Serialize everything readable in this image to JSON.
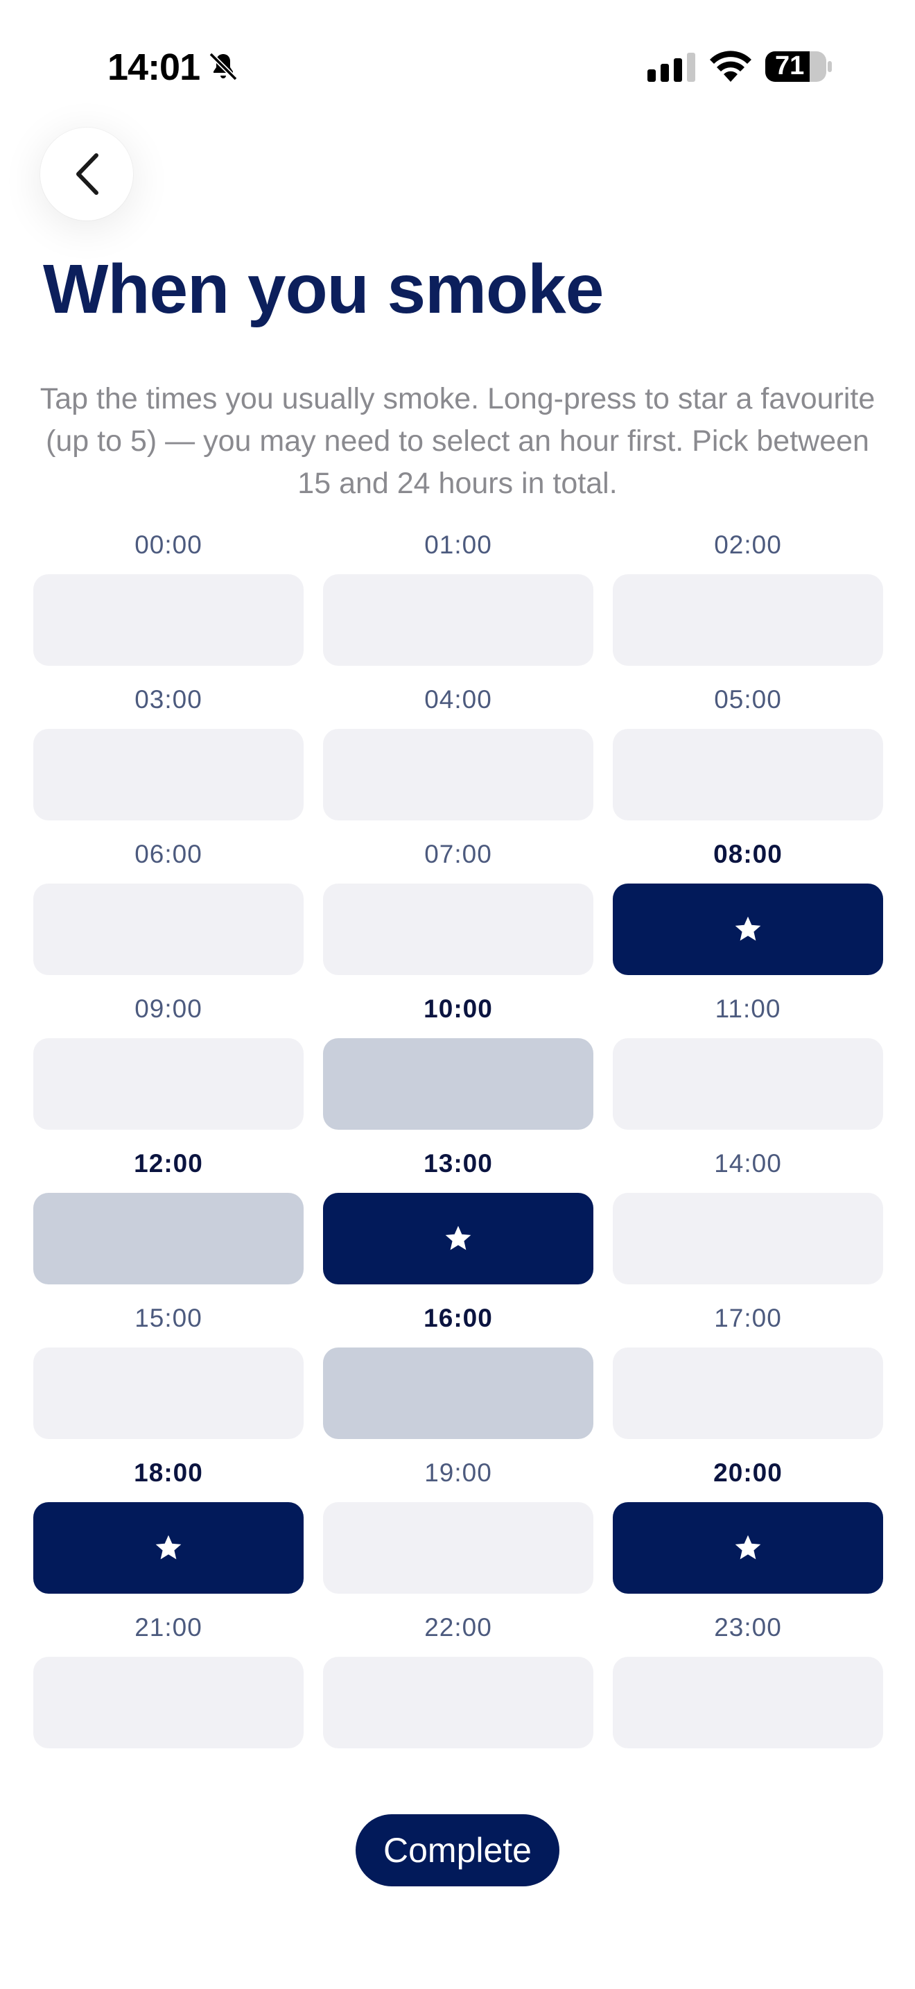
{
  "status_bar": {
    "time": "14:01",
    "battery": "71",
    "icons": [
      "bell-slash-icon",
      "cellular-signal-icon",
      "wifi-icon",
      "battery-icon"
    ]
  },
  "header": {
    "back_icon": "chevron-left-icon",
    "title": "When you smoke"
  },
  "instructions": "Tap the times you usually smoke. Long-press to star a favourite (up to 5) — you may need to select an hour first. Pick between 15 and 24 hours in total.",
  "hours": [
    {
      "label": "00:00",
      "state": "off"
    },
    {
      "label": "01:00",
      "state": "off"
    },
    {
      "label": "02:00",
      "state": "off"
    },
    {
      "label": "03:00",
      "state": "off"
    },
    {
      "label": "04:00",
      "state": "off"
    },
    {
      "label": "05:00",
      "state": "off"
    },
    {
      "label": "06:00",
      "state": "off"
    },
    {
      "label": "07:00",
      "state": "off"
    },
    {
      "label": "08:00",
      "state": "favourite"
    },
    {
      "label": "09:00",
      "state": "off"
    },
    {
      "label": "10:00",
      "state": "selected"
    },
    {
      "label": "11:00",
      "state": "off"
    },
    {
      "label": "12:00",
      "state": "selected"
    },
    {
      "label": "13:00",
      "state": "favourite"
    },
    {
      "label": "14:00",
      "state": "off"
    },
    {
      "label": "15:00",
      "state": "off"
    },
    {
      "label": "16:00",
      "state": "selected"
    },
    {
      "label": "17:00",
      "state": "off"
    },
    {
      "label": "18:00",
      "state": "favourite"
    },
    {
      "label": "19:00",
      "state": "off"
    },
    {
      "label": "20:00",
      "state": "favourite"
    },
    {
      "label": "21:00",
      "state": "off"
    },
    {
      "label": "22:00",
      "state": "off"
    },
    {
      "label": "23:00",
      "state": "off"
    }
  ],
  "complete_label": "Complete",
  "colors": {
    "brand_navy": "#021a5a",
    "title": "#0c1f5c",
    "slot_off": "#f1f1f5",
    "slot_selected": "#c9cfdb",
    "instructions": "#8a8a8f"
  }
}
